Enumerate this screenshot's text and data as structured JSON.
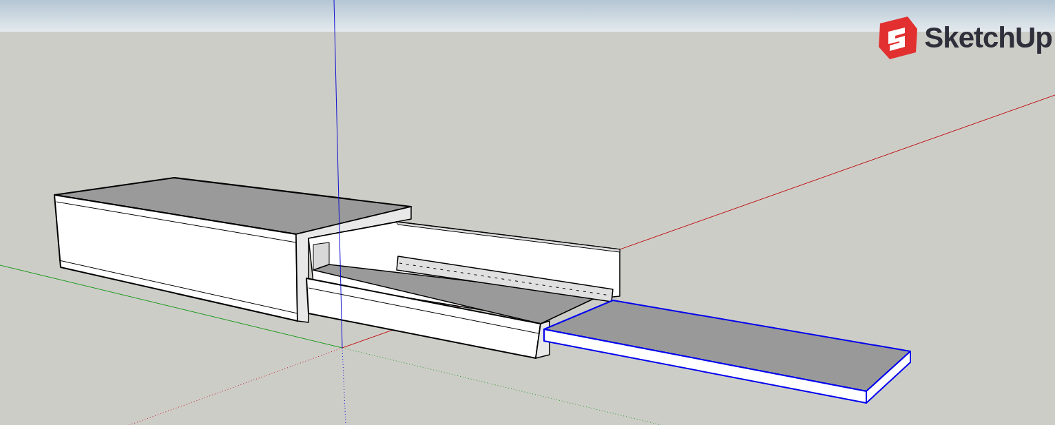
{
  "logo": {
    "text": "SketchUp"
  }
}
